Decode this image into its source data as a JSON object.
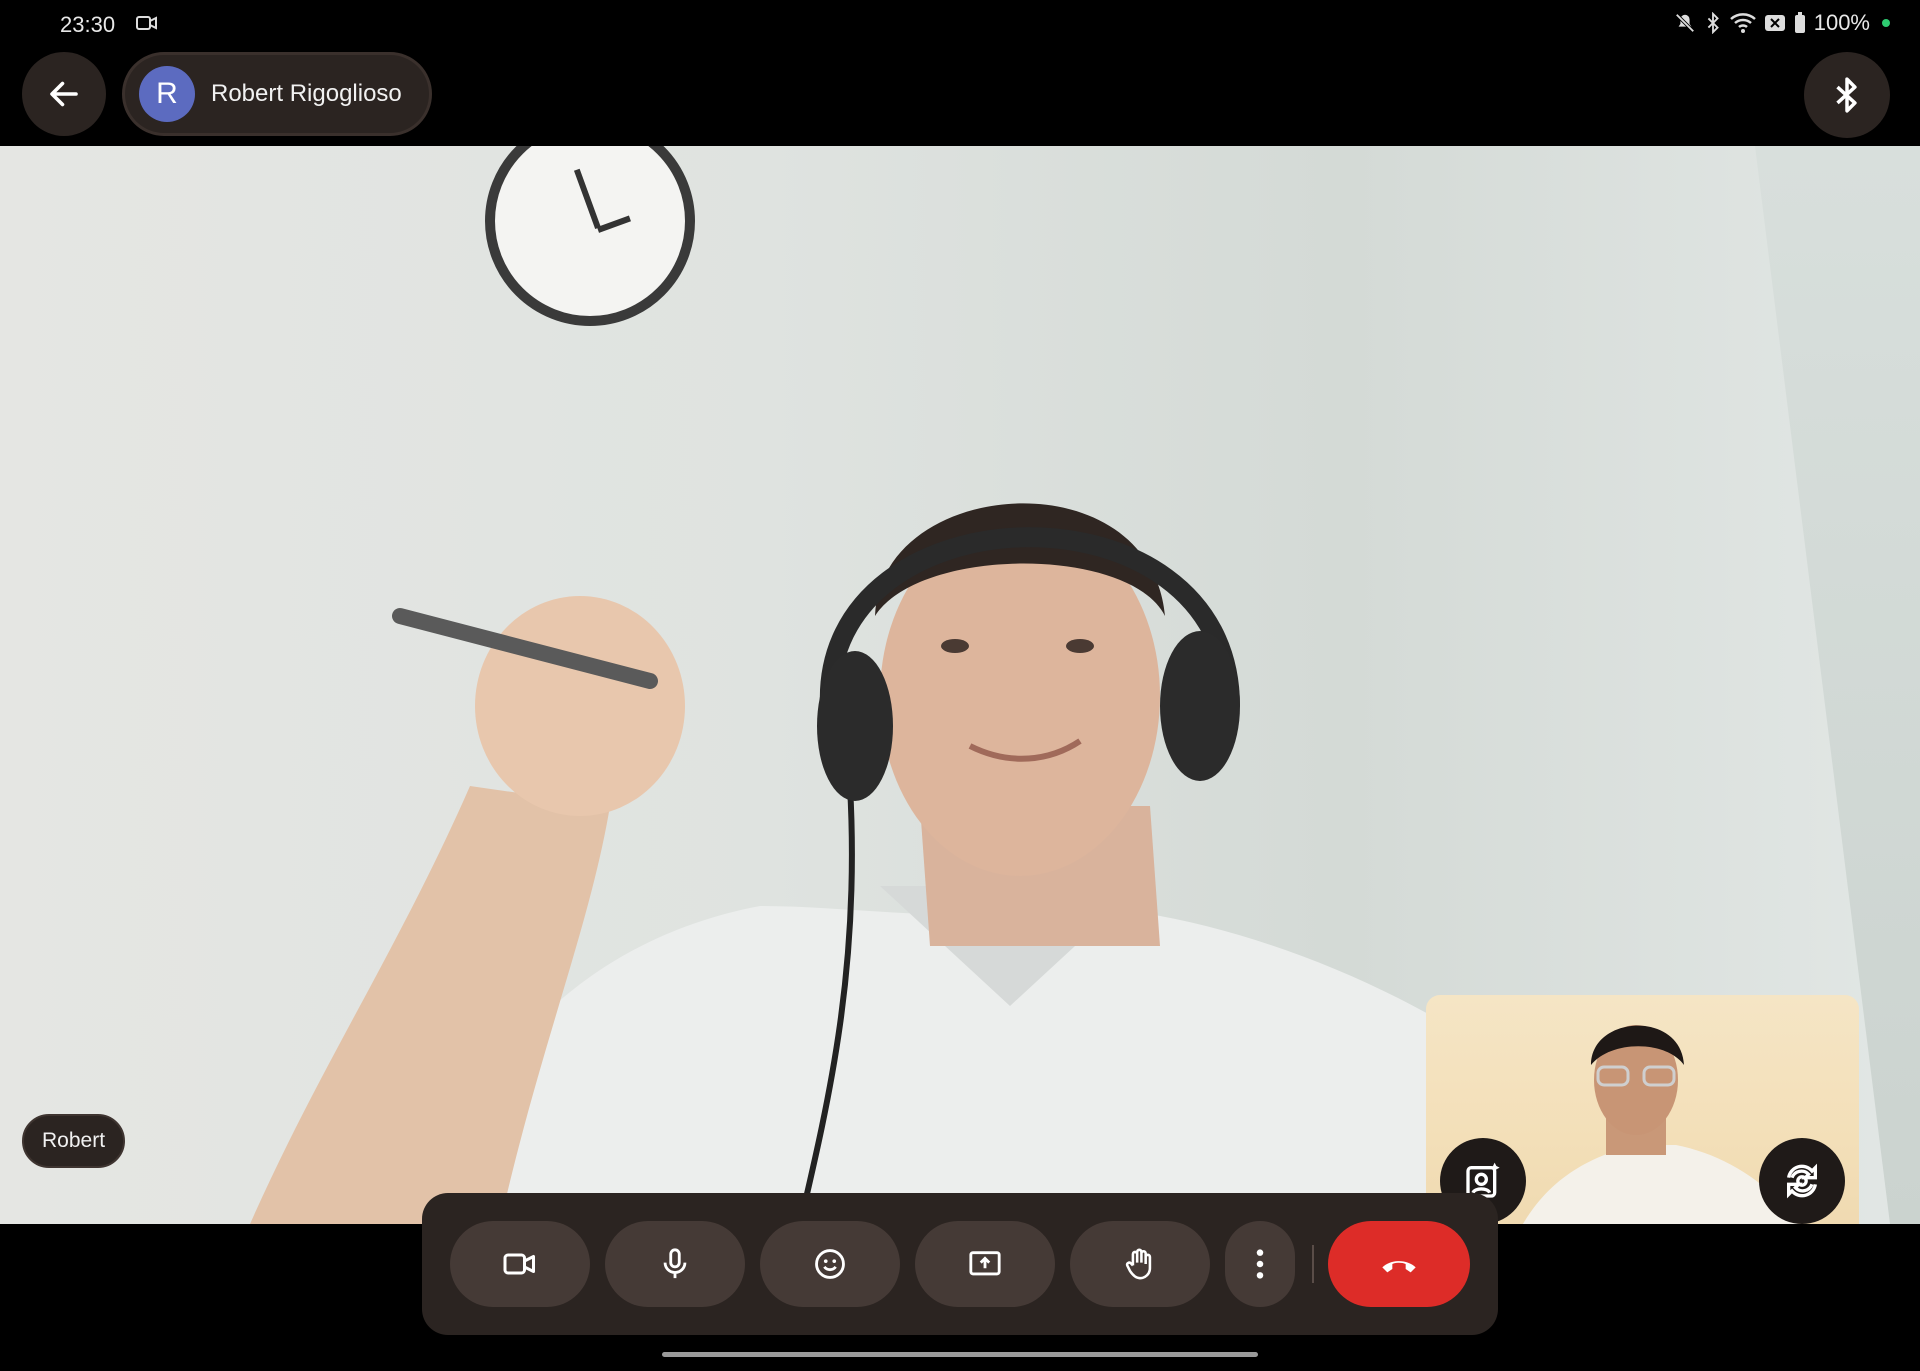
{
  "status_bar": {
    "time": "23:30",
    "battery": "100%",
    "icons": [
      "video-record-icon",
      "mute-icon",
      "bluetooth-icon",
      "wifi-icon",
      "no-sim-icon",
      "battery-icon"
    ]
  },
  "header": {
    "participant_initial": "R",
    "participant_name": "Robert Rigoglioso",
    "avatar_color": "#5c6bc0"
  },
  "main_video": {
    "name_tag": "Robert"
  },
  "controls": {
    "buttons": [
      "camera-icon",
      "microphone-icon",
      "emoji-icon",
      "present-screen-icon",
      "raise-hand-icon",
      "more-options-icon",
      "end-call-icon"
    ],
    "end_call_color": "#dd2c28"
  },
  "self_view": {
    "buttons": [
      "effects-icon",
      "flip-camera-icon"
    ]
  }
}
